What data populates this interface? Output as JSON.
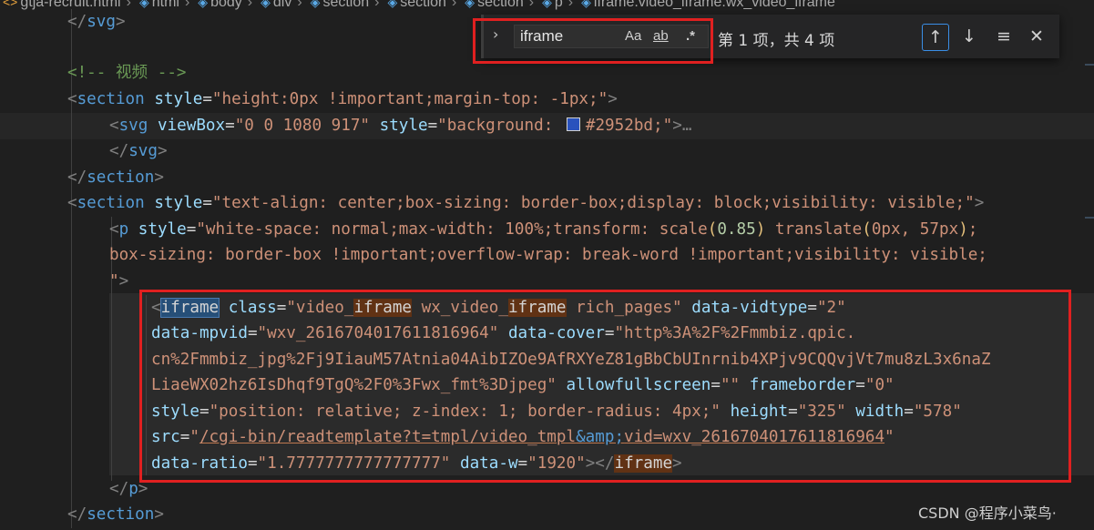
{
  "breadcrumb": {
    "items": [
      {
        "label": "gtja-recruit.html",
        "icon": "html-file-icon"
      },
      {
        "label": "html",
        "icon": "element-icon"
      },
      {
        "label": "body",
        "icon": "element-icon"
      },
      {
        "label": "div",
        "icon": "element-icon"
      },
      {
        "label": "section",
        "icon": "element-icon"
      },
      {
        "label": "section",
        "icon": "element-icon"
      },
      {
        "label": "section",
        "icon": "element-icon"
      },
      {
        "label": "p",
        "icon": "element-icon"
      },
      {
        "label": "iframe.video_iframe.wx_video_iframe",
        "icon": "element-icon"
      }
    ]
  },
  "find": {
    "query": "iframe",
    "match_case_label": "Aa",
    "whole_word_label": "ab",
    "regex_label": ".*",
    "match_count": "第 1 项，共 4 项"
  },
  "code": {
    "l1_tag": "svg",
    "l2_comment": "<!-- 视频 -->",
    "l3_tag": "section",
    "l3_attr": "style",
    "l3_val": "\"height:0px !important;margin-top: -1px;\"",
    "l4_tag": "svg",
    "l4_attr1": "viewBox",
    "l4_val1": "\"0 0 1080 917\"",
    "l4_attr2": "style",
    "l4_val2a": "\"background: ",
    "l4_val2b": "#2952bd;\"",
    "l4_ellipsis": "…",
    "swatch_color": "#2952bd",
    "l5_tag": "svg",
    "l6_tag": "section",
    "l7_tag": "section",
    "l7_attr": "style",
    "l7_val": "\"text-align: center;box-sizing: border-box;display: block;visibility: visible;\"",
    "l8_tag": "p",
    "l8_attr": "style",
    "l8_val_a": "\"white-space: normal;max-width: 100%;transform: scale",
    "l8_paren1": "(",
    "l8_val_b": "0.85",
    "l8_paren2": ")",
    "l8_val_c": " translate",
    "l8_paren3": "(",
    "l8_val_d": "0px, 57px",
    "l8_paren4": ")",
    "l8_val_e": ";",
    "l9_val": "box-sizing: border-box !important;overflow-wrap: break-word !important;visibility: visible;",
    "l10_val": "\"",
    "l11_tag": "iframe",
    "l11_attr1": "class",
    "l11_val1a": "\"video_",
    "l11_val1b": "iframe",
    "l11_val1c": " wx_video_",
    "l11_val1d": "iframe",
    "l11_val1e": " rich_pages\"",
    "l11_attr2": "data-vidtype",
    "l11_val2": "\"2\"",
    "l12_attr": "data-mpvid",
    "l12_val": "\"wxv_2616704017611816964\"",
    "l12_attr2": "data-cover",
    "l12_val2": "\"http%3A%2F%2Fmmbiz.qpic.",
    "l13_val": "cn%2Fmmbiz_jpg%2Fj9IiauM57Atnia04AibIZOe9AfRXYeZ81gBbCbUInrnib4XPjv9CQQvjVt7mu8zL3x6naZ",
    "l14_val": "LiaeWX02hz6IsDhqf9TgQ%2F0%3Fwx_fmt%3Djpeg\"",
    "l14_attr1": "allowfullscreen",
    "l14_val1": "\"\"",
    "l14_attr2": "frameborder",
    "l14_val2": "\"0\"",
    "l15_attr1": "style",
    "l15_val1": "\"position: relative; z-index: 1; border-radius: 4px;\"",
    "l15_attr2": "height",
    "l15_val2": "\"325\"",
    "l15_attr3": "width",
    "l15_val3": "\"578\"",
    "l16_attr": "src",
    "l16_q1": "\"",
    "l16_link": "/cgi-bin/readtemplate?t=tmpl/video_tmpl",
    "l16_amp": "&amp;",
    "l16_link2": "vid=wxv_2616704017611816964",
    "l16_q2": "\"",
    "l17_attr1": "data-ratio",
    "l17_val1": "\"1.7777777777777777\"",
    "l17_attr2": "data-w",
    "l17_val2": "\"1920\"",
    "l17_close": "iframe",
    "l18_tag": "p",
    "l19_tag": "section"
  },
  "watermark": "CSDN @程序小菜鸟·"
}
